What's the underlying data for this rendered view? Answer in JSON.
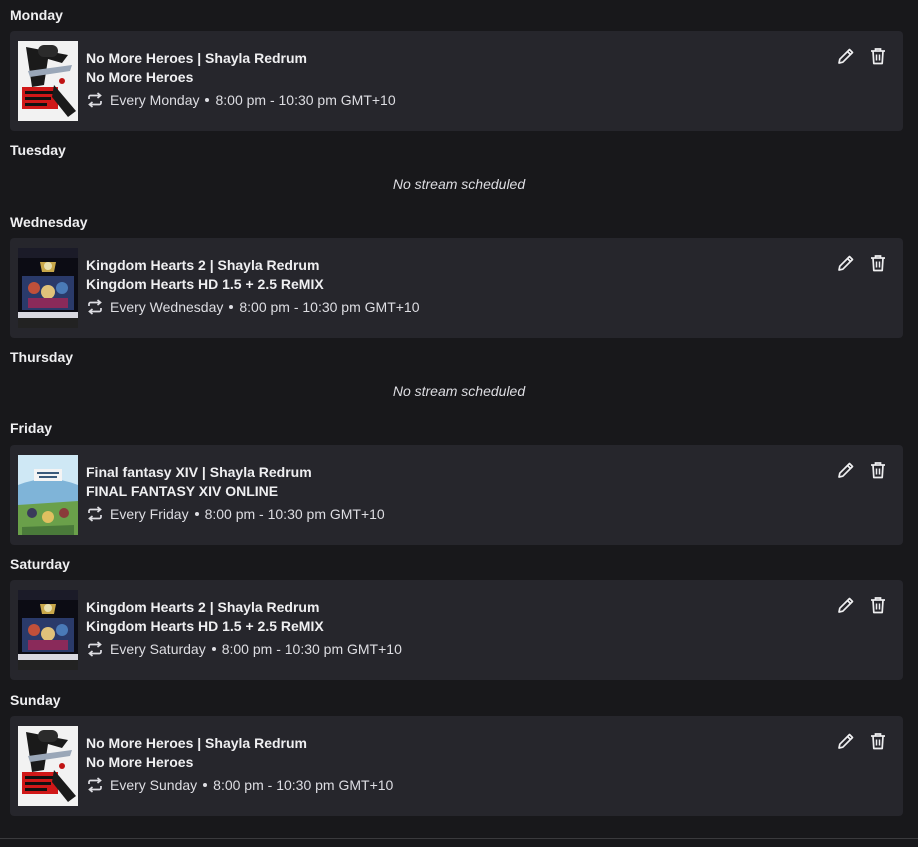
{
  "schedule": {
    "days": [
      {
        "name": "Monday",
        "streams": [
          {
            "title": "No More Heroes | Shayla Redrum",
            "game": "No More Heroes",
            "recurrence": "Every Monday",
            "time": "8:00 pm - 10:30 pm GMT+10",
            "thumbnail_icon": "no-more-heroes-boxart"
          }
        ]
      },
      {
        "name": "Tuesday",
        "empty_text": "No stream scheduled",
        "streams": []
      },
      {
        "name": "Wednesday",
        "streams": [
          {
            "title": "Kingdom Hearts 2 | Shayla Redrum",
            "game": "Kingdom Hearts HD 1.5 + 2.5 ReMIX",
            "recurrence": "Every Wednesday",
            "time": "8:00 pm - 10:30 pm GMT+10",
            "thumbnail_icon": "kingdom-hearts-boxart"
          }
        ]
      },
      {
        "name": "Thursday",
        "empty_text": "No stream scheduled",
        "streams": []
      },
      {
        "name": "Friday",
        "streams": [
          {
            "title": "Final fantasy XIV | Shayla Redrum",
            "game": "FINAL FANTASY XIV ONLINE",
            "recurrence": "Every Friday",
            "time": "8:00 pm - 10:30 pm GMT+10",
            "thumbnail_icon": "final-fantasy-xiv-boxart"
          }
        ]
      },
      {
        "name": "Saturday",
        "streams": [
          {
            "title": "Kingdom Hearts 2 | Shayla Redrum",
            "game": "Kingdom Hearts HD 1.5 + 2.5 ReMIX",
            "recurrence": "Every Saturday",
            "time": "8:00 pm - 10:30 pm GMT+10",
            "thumbnail_icon": "kingdom-hearts-boxart"
          }
        ]
      },
      {
        "name": "Sunday",
        "streams": [
          {
            "title": "No More Heroes | Shayla Redrum",
            "game": "No More Heroes",
            "recurrence": "Every Sunday",
            "time": "8:00 pm - 10:30 pm GMT+10",
            "thumbnail_icon": "no-more-heroes-boxart"
          }
        ]
      }
    ]
  },
  "icons": {
    "recurrence": "repeat-icon",
    "edit": "pencil-icon",
    "delete": "trash-icon"
  },
  "colors": {
    "page_background": "#18181b",
    "card_background": "#26262c",
    "text_primary": "#efeff1",
    "text_secondary": "#dedee3"
  }
}
